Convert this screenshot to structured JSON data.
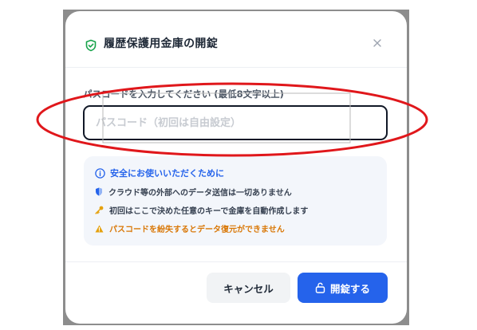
{
  "dialog": {
    "title": "履歴保護用金庫の開錠",
    "close_label": "×"
  },
  "form": {
    "label": "パスコードを入力してください (最低8文字以上)",
    "placeholder": "パスコード（初回は自由設定）",
    "value": ""
  },
  "info": {
    "heading": "安全にお使いいただくために",
    "items": [
      {
        "icon": "shield-half-icon",
        "text": "クラウド等の外部へのデータ送信は一切ありません"
      },
      {
        "icon": "key-icon",
        "text": "初回はここで決めた任意のキーで金庫を自動作成します"
      },
      {
        "icon": "warning-icon",
        "text": "パスコードを紛失するとデータ復元ができません"
      }
    ]
  },
  "footer": {
    "cancel_label": "キャンセル",
    "unlock_label": "開錠する"
  },
  "colors": {
    "accent": "#2563eb",
    "title_icon": "#16a34a",
    "warning": "#d97706",
    "annotation": "#e0171b"
  }
}
